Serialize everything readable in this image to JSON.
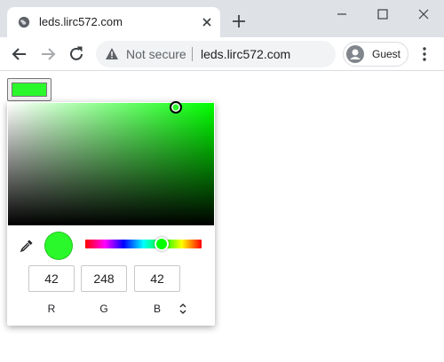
{
  "browser": {
    "tab": {
      "title": "leds.lirc572.com",
      "favicon": "globe-icon"
    },
    "new_tab_icon": "plus-icon",
    "window_controls": [
      "minimize-icon",
      "maximize-icon",
      "close-icon"
    ],
    "nav": {
      "back_icon": "arrow-left-icon",
      "forward_icon": "arrow-right-icon",
      "reload_icon": "reload-icon"
    },
    "omnibox": {
      "security_icon": "warning-icon",
      "security_text": "Not secure",
      "url": "leds.lirc572.com"
    },
    "profile": {
      "icon": "person-icon",
      "label": "Guest"
    },
    "menu_icon": "kebab-menu-icon"
  },
  "page": {
    "color_input": {
      "value": "#2af82a"
    },
    "picker": {
      "hue_color": "#00ff00",
      "selected_color": "#2af82a",
      "eyedropper_icon": "eyedropper-icon",
      "channels": [
        {
          "label": "R",
          "value": "42"
        },
        {
          "label": "G",
          "value": "248"
        },
        {
          "label": "B",
          "value": "42"
        }
      ],
      "format_toggle_icon": "up-down-arrows-icon"
    }
  }
}
